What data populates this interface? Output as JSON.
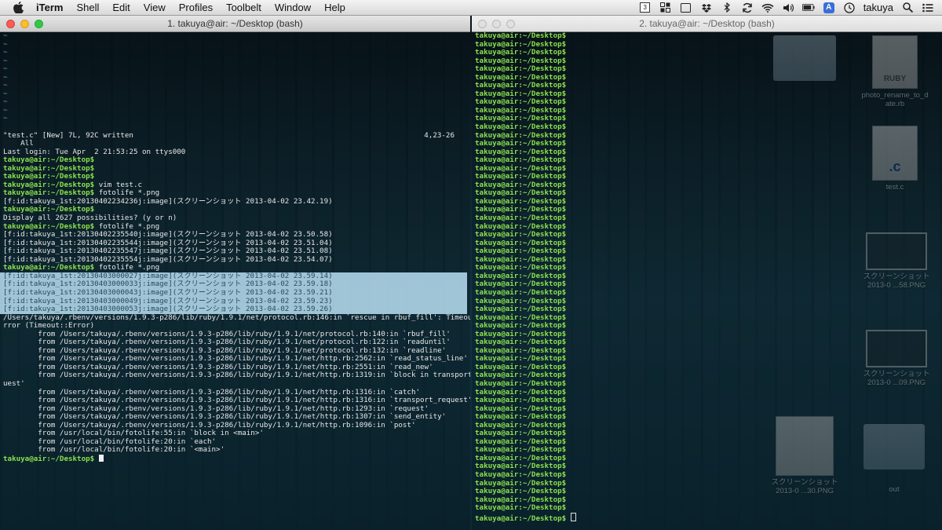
{
  "menubar": {
    "items": [
      "iTerm",
      "Shell",
      "Edit",
      "View",
      "Profiles",
      "Toolbelt",
      "Window",
      "Help"
    ],
    "space_badge": "3",
    "input_badge": "A",
    "user": "takuya"
  },
  "window1": {
    "title": "1. takuya@air: ~/Desktop (bash)",
    "vim_tildes": [
      "~",
      "~",
      "~",
      "~",
      "~",
      "~",
      "~",
      "~",
      "~",
      "~",
      "~"
    ],
    "vim_status": {
      "left": "\"test.c\" [New] 7L, 92C written",
      "right": "4,23-26"
    },
    "vim_all": "    All",
    "lines": [
      {
        "type": "text",
        "text": "Last login: Tue Apr  2 21:53:25 on ttys000"
      },
      {
        "type": "prompt",
        "prompt": "takuya@air:~/Desktop$",
        "cmd": ""
      },
      {
        "type": "prompt",
        "prompt": "takuya@air:~/Desktop$",
        "cmd": ""
      },
      {
        "type": "prompt",
        "prompt": "takuya@air:~/Desktop$",
        "cmd": ""
      },
      {
        "type": "prompt",
        "prompt": "takuya@air:~/Desktop$",
        "cmd": " vim test.c"
      },
      {
        "type": "prompt",
        "prompt": "takuya@air:~/Desktop$",
        "cmd": " fotolife *.png"
      },
      {
        "type": "text",
        "text": "[f:id:takuya_1st:20130402234236j:image](スクリーンショット 2013-04-02 23.42.19)"
      },
      {
        "type": "prompt",
        "prompt": "takuya@air:~/Desktop$",
        "cmd": ""
      },
      {
        "type": "text",
        "text": "Display all 2627 possibilities? (y or n)"
      },
      {
        "type": "prompt",
        "prompt": "takuya@air:~/Desktop$",
        "cmd": " fotolife *.png"
      },
      {
        "type": "text",
        "text": "[f:id:takuya_1st:20130402235540j:image](スクリーンショット 2013-04-02 23.50.58)"
      },
      {
        "type": "text",
        "text": "[f:id:takuya_1st:20130402235544j:image](スクリーンショット 2013-04-02 23.51.04)"
      },
      {
        "type": "text",
        "text": "[f:id:takuya_1st:20130402235547j:image](スクリーンショット 2013-04-02 23.51.08)"
      },
      {
        "type": "text",
        "text": "[f:id:takuya_1st:20130402235554j:image](スクリーンショット 2013-04-02 23.54.07)"
      },
      {
        "type": "prompt",
        "prompt": "takuya@air:~/Desktop$",
        "cmd": " fotolife *.png"
      },
      {
        "type": "hl",
        "text": "[f:id:takuya_1st:20130403000027j:image](スクリーンショット 2013-04-02 23.59.14)"
      },
      {
        "type": "hl",
        "text": "[f:id:takuya_1st:20130403000033j:image](スクリーンショット 2013-04-02 23.59.18)"
      },
      {
        "type": "hl",
        "text": "[f:id:takuya_1st:20130403000043j:image](スクリーンショット 2013-04-02 23.59.21)"
      },
      {
        "type": "hl",
        "text": "[f:id:takuya_1st:20130403000049j:image](スクリーンショット 2013-04-02 23.59.23)"
      },
      {
        "type": "hl",
        "text": "[f:id:takuya_1st:20130403000053j:image](スクリーンショット 2013-04-02 23.59.26)"
      },
      {
        "type": "text",
        "text": "/Users/takuya/.rbenv/versions/1.9.3-p286/lib/ruby/1.9.1/net/protocol.rb:146:in `rescue in rbuf_fill': Timeout::E"
      },
      {
        "type": "text",
        "text": "rror (Timeout::Error)"
      },
      {
        "type": "text",
        "text": "        from /Users/takuya/.rbenv/versions/1.9.3-p286/lib/ruby/1.9.1/net/protocol.rb:140:in `rbuf_fill'"
      },
      {
        "type": "text",
        "text": "        from /Users/takuya/.rbenv/versions/1.9.3-p286/lib/ruby/1.9.1/net/protocol.rb:122:in `readuntil'"
      },
      {
        "type": "text",
        "text": "        from /Users/takuya/.rbenv/versions/1.9.3-p286/lib/ruby/1.9.1/net/protocol.rb:132:in `readline'"
      },
      {
        "type": "text",
        "text": "        from /Users/takuya/.rbenv/versions/1.9.3-p286/lib/ruby/1.9.1/net/http.rb:2562:in `read_status_line'"
      },
      {
        "type": "text",
        "text": "        from /Users/takuya/.rbenv/versions/1.9.3-p286/lib/ruby/1.9.1/net/http.rb:2551:in `read_new'"
      },
      {
        "type": "text",
        "text": "        from /Users/takuya/.rbenv/versions/1.9.3-p286/lib/ruby/1.9.1/net/http.rb:1319:in `block in transport_req"
      },
      {
        "type": "text",
        "text": "uest'"
      },
      {
        "type": "text",
        "text": "        from /Users/takuya/.rbenv/versions/1.9.3-p286/lib/ruby/1.9.1/net/http.rb:1316:in `catch'"
      },
      {
        "type": "text",
        "text": "        from /Users/takuya/.rbenv/versions/1.9.3-p286/lib/ruby/1.9.1/net/http.rb:1316:in `transport_request'"
      },
      {
        "type": "text",
        "text": "        from /Users/takuya/.rbenv/versions/1.9.3-p286/lib/ruby/1.9.1/net/http.rb:1293:in `request'"
      },
      {
        "type": "text",
        "text": "        from /Users/takuya/.rbenv/versions/1.9.3-p286/lib/ruby/1.9.1/net/http.rb:1307:in `send_entity'"
      },
      {
        "type": "text",
        "text": "        from /Users/takuya/.rbenv/versions/1.9.3-p286/lib/ruby/1.9.1/net/http.rb:1096:in `post'"
      },
      {
        "type": "text",
        "text": "        from /usr/local/bin/fotolife:55:in `block in <main>'"
      },
      {
        "type": "text",
        "text": "        from /usr/local/bin/fotolife:20:in `each'"
      },
      {
        "type": "text",
        "text": "        from /usr/local/bin/fotolife:20:in `<main>'"
      },
      {
        "type": "prompt_cursor",
        "prompt": "takuya@air:~/Desktop$",
        "cmd": " "
      }
    ]
  },
  "window2": {
    "title": "2. takuya@air: ~/Desktop (bash)",
    "prompt": "takuya@air:~/Desktop$",
    "line_count": 59
  },
  "desktop_icons": [
    {
      "kind": "doc",
      "badge": "RUBY",
      "label": "photo_rename_to_d\nate.rb"
    },
    {
      "kind": "doc",
      "badge": ".c",
      "label": "test.c"
    },
    {
      "kind": "thumb",
      "badge": "",
      "label": "スクリーンショット\n2013-0 ...58.PNG"
    },
    {
      "kind": "thumb",
      "badge": "",
      "label": "スクリーンショット\n2013-0 ...09.PNG"
    },
    {
      "kind": "thumb",
      "badge": "",
      "label": "スクリーンショット\n2013-0 ...30.PNG"
    },
    {
      "kind": "folder",
      "badge": "",
      "label": "out"
    }
  ]
}
